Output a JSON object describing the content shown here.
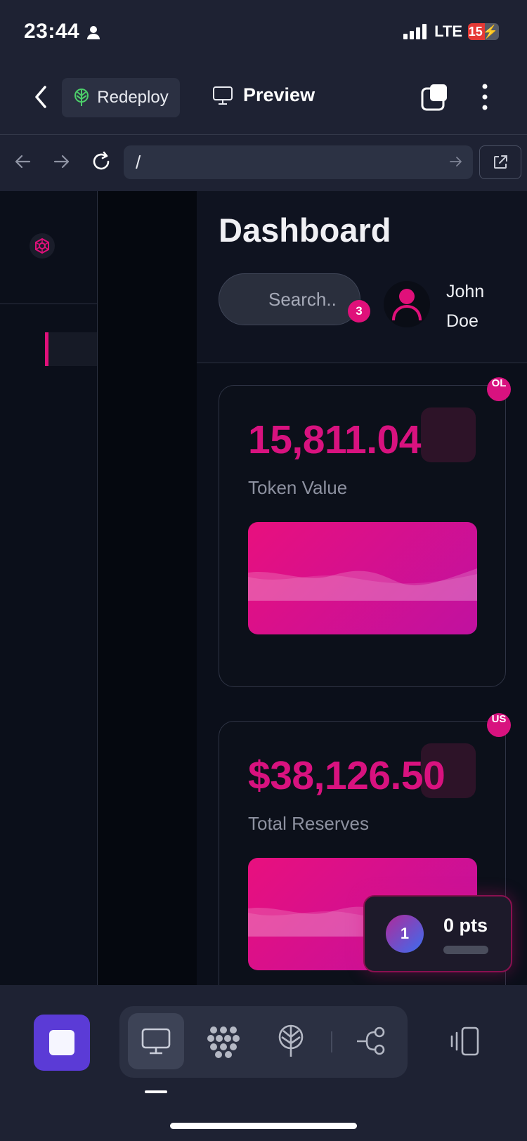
{
  "status_bar": {
    "time": "23:44",
    "network": "LTE",
    "battery": "15"
  },
  "topbar": {
    "redeploy_label": "Redeploy",
    "preview_label": "Preview"
  },
  "urlbar": {
    "url": "/"
  },
  "dashboard": {
    "title": "Dashboard",
    "search_placeholder": "Search..",
    "notification_count": "3",
    "user_first": "John",
    "user_last": "Doe"
  },
  "cards": [
    {
      "value": "15,811.04",
      "label": "Token Value",
      "corner": "OL"
    },
    {
      "value": "$38,126.50",
      "label": "Total Reserves",
      "corner": "US"
    }
  ],
  "points_widget": {
    "level": "1",
    "points": "0 pts"
  },
  "colors": {
    "accent": "#e0107a",
    "stop_button": "#5b3bd6"
  }
}
